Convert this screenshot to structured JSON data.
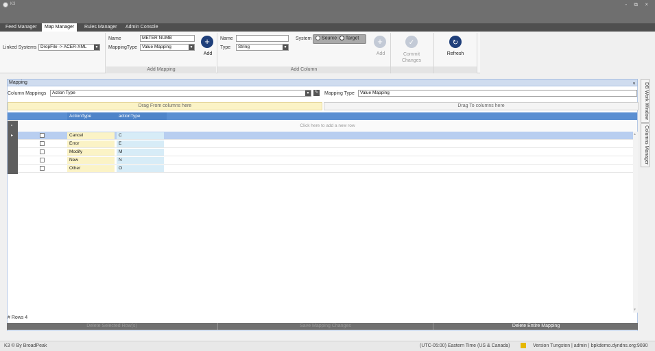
{
  "window": {
    "title": "K3",
    "controls": "- ⧉ ×"
  },
  "tabs": [
    {
      "label": "Feed Manager"
    },
    {
      "label": "Map Manager"
    },
    {
      "label": "Rules Manager"
    },
    {
      "label": "Admin Console"
    }
  ],
  "ribbon": {
    "linked_systems_label": "Linked Systems",
    "linked_systems_value": "DropFile -> ACER-XML",
    "add_mapping": {
      "name_label": "Name",
      "name_value": "METER NUMB",
      "mapping_type_label": "MappingType",
      "mapping_type_value": "Value Mapping",
      "add_label": "Add",
      "group_label": "Add Mapping"
    },
    "add_column": {
      "name_label": "Name",
      "name_value": "",
      "type_label": "Type",
      "type_value": "String",
      "system_label": "System",
      "source_label": "Source",
      "target_label": "Target",
      "add_label": "Add",
      "group_label": "Add Column"
    },
    "commit_label": "Commit Changes",
    "refresh_label": "Refresh"
  },
  "mapping_panel": {
    "title": "Mapping",
    "pin": "ᵩ",
    "column_mappings_label": "Column Mappings",
    "column_mappings_value": "Action Type",
    "mapping_type_label": "Mapping Type",
    "mapping_type_value": "Value Mapping",
    "drag_from": "Drag From columns here",
    "drag_to": "Drag To columns here",
    "grid": {
      "columns": [
        "ActionType",
        "actionType"
      ],
      "new_row_text": "Click here to add a new row",
      "rows": [
        {
          "a": "Cancel",
          "b": "C"
        },
        {
          "a": "Error",
          "b": "E"
        },
        {
          "a": "Modify",
          "b": "M"
        },
        {
          "a": "New",
          "b": "N"
        },
        {
          "a": "Other",
          "b": "O"
        }
      ]
    },
    "rows_count": "# Rows 4",
    "delete_selected": "Delete Selected Row(s)",
    "save_changes": "Save Mapping Changes",
    "delete_entire": "Delete Entire Mapping"
  },
  "side_tabs": {
    "db_work_window": "DB Work Window",
    "columns_manager": "Columns Manager"
  },
  "status": {
    "left": "K3 © By BroadPeak",
    "timezone": "(UTC-05:00) Eastern Time (US & Canada)",
    "version": "Version Tungsten | admin | bpkdemo.dyndns.org:9090"
  },
  "colors": {
    "accent": "#1f3f7a",
    "grid_header": "#5b8fd2",
    "from_cell": "#fbf3c6",
    "to_cell": "#d7ecf7"
  }
}
